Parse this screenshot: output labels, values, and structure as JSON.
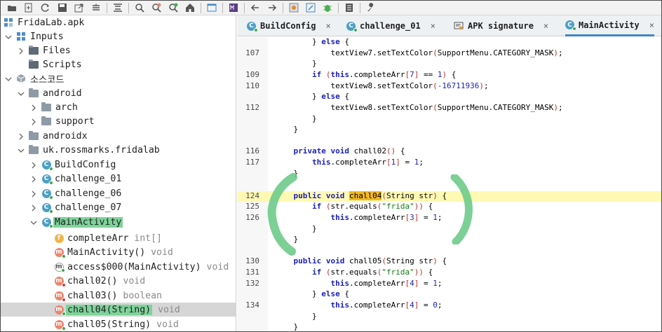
{
  "toolbar": {
    "icons": [
      "open-folder-icon",
      "add-file-icon",
      "refresh-icon",
      "save-icon",
      "export-icon",
      "sync-tree-icon",
      "flatten-icon",
      "search-icon",
      "search-class-icon",
      "search-usage-icon",
      "home-icon",
      "window-icon",
      "bytecode-icon",
      "back-icon",
      "forward-icon",
      "settings-gear-icon",
      "decompile-icon",
      "debug-bug-icon",
      "log-icon",
      "wrench-icon"
    ]
  },
  "tree": {
    "root": "FridaLab.apk",
    "inputs": "Inputs",
    "files": "Files",
    "scripts": "Scripts",
    "source_code": "소스코드",
    "android": "android",
    "arch": "arch",
    "support": "support",
    "androidx": "androidx",
    "package": "uk.rossmarks.fridalab",
    "classes": [
      "BuildConfig",
      "challenge_01",
      "challenge_06",
      "challenge_07",
      "MainActivity"
    ],
    "members": [
      {
        "name": "completeArr",
        "type": "int[]",
        "kind": "f"
      },
      {
        "name": "MainActivity()",
        "type": "void",
        "kind": "m"
      },
      {
        "name": "access$000(MainActivity)",
        "type": "void",
        "kind": "m"
      },
      {
        "name": "chall02()",
        "type": "void",
        "kind": "m"
      },
      {
        "name": "chall03()",
        "type": "boolean",
        "kind": "m"
      },
      {
        "name": "chall04(String)",
        "type": "void",
        "kind": "m"
      },
      {
        "name": "chall05(String)",
        "type": "void",
        "kind": "m"
      }
    ]
  },
  "tabs": [
    {
      "label": "BuildConfig",
      "close": "×"
    },
    {
      "label": "challenge_01",
      "close": "×"
    },
    {
      "label": "APK signature",
      "close": "×"
    },
    {
      "label": "MainActivity",
      "close": "×"
    }
  ],
  "code": {
    "lines": [
      {
        "n": "",
        "t": "        } else {"
      },
      {
        "n": "107",
        "t": "            textView7.setTextColor(SupportMenu.CATEGORY_MASK);"
      },
      {
        "n": "",
        "t": "        }"
      },
      {
        "n": "109",
        "t": "        if (this.completeArr[7] == 1) {"
      },
      {
        "n": "110",
        "t": "            textView8.setTextColor(-16711936);"
      },
      {
        "n": "",
        "t": "        } else {"
      },
      {
        "n": "112",
        "t": "            textView8.setTextColor(SupportMenu.CATEGORY_MASK);"
      },
      {
        "n": "",
        "t": "        }"
      },
      {
        "n": "",
        "t": "    }"
      },
      {
        "n": "",
        "t": ""
      },
      {
        "n": "116",
        "t": "    private void chall02() {"
      },
      {
        "n": "117",
        "t": "        this.completeArr[1] = 1;"
      },
      {
        "n": "",
        "t": "    }"
      },
      {
        "n": "",
        "t": ""
      },
      {
        "n": "124",
        "t": "    public void chall04(String str) {"
      },
      {
        "n": "125",
        "t": "        if (str.equals(\"frida\")) {"
      },
      {
        "n": "126",
        "t": "            this.completeArr[3] = 1;"
      },
      {
        "n": "",
        "t": "        }"
      },
      {
        "n": "",
        "t": "    }"
      },
      {
        "n": "",
        "t": ""
      },
      {
        "n": "130",
        "t": "    public void chall05(String str) {"
      },
      {
        "n": "131",
        "t": "        if (str.equals(\"frida\")) {"
      },
      {
        "n": "132",
        "t": "            this.completeArr[4] = 1;"
      },
      {
        "n": "",
        "t": "        } else {"
      },
      {
        "n": "134",
        "t": "            this.completeArr[4] = 0;"
      },
      {
        "n": "",
        "t": "        }"
      },
      {
        "n": "",
        "t": "    }"
      }
    ],
    "highlighted_word": "chall04"
  }
}
